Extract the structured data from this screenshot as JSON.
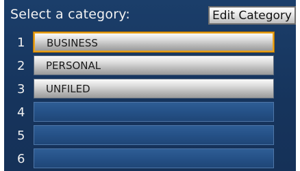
{
  "title": "Select a category:",
  "edit_button": "Edit Category",
  "rows": [
    {
      "number": "1",
      "label": "BUSINESS"
    },
    {
      "number": "2",
      "label": "PERSONAL"
    },
    {
      "number": "3",
      "label": "UNFILED"
    },
    {
      "number": "4",
      "label": ""
    },
    {
      "number": "5",
      "label": ""
    },
    {
      "number": "6",
      "label": ""
    }
  ],
  "colors": {
    "background": "#16345c",
    "selection_border": "#e9a21a",
    "empty_slot": "#255187"
  }
}
